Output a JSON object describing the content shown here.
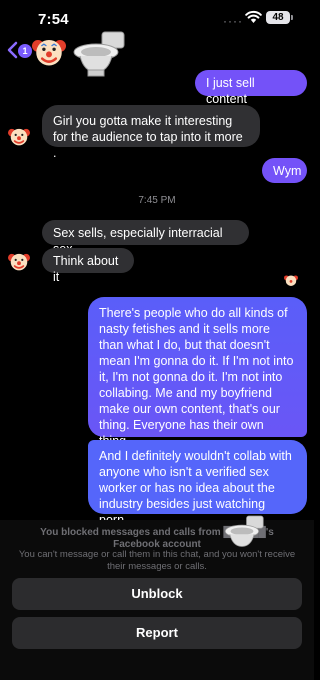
{
  "status_bar": {
    "time": "7:54",
    "signal": "····",
    "battery": "48"
  },
  "header": {
    "back_badge": "1",
    "avatar_icon": "clown-face-icon",
    "decoration_icon": "toilet-icon"
  },
  "messages": {
    "m1": "I just sell content",
    "m2": "Girl you gotta make it interesting for the audience to tap into it more .",
    "m3": "Wym",
    "timestamp": "7:45 PM",
    "m4": "Sex sells, especially interracial sex",
    "m5": "Think about it",
    "m6": "There's people who do all kinds of nasty fetishes and it sells more than what I do, but that doesn't mean I'm gonna do it. If I'm not into it, I'm not gonna do it. I'm not into collabing. Me and my boyfriend make our own content, that's our thing. Everyone has their own thing.",
    "m7": "And I definitely wouldn't collab with anyone who isn't a verified sex worker or has no idea about the industry besides just watching porn."
  },
  "blocked": {
    "title": "You blocked messages and calls from ██████'s Facebook account",
    "description": "You can't message or call them in this chat, and you won't receive their messages or calls.",
    "unblock_label": "Unblock",
    "report_label": "Report"
  },
  "colors": {
    "outgoing": "#7452f8",
    "incoming": "#303033",
    "background": "#000000"
  }
}
